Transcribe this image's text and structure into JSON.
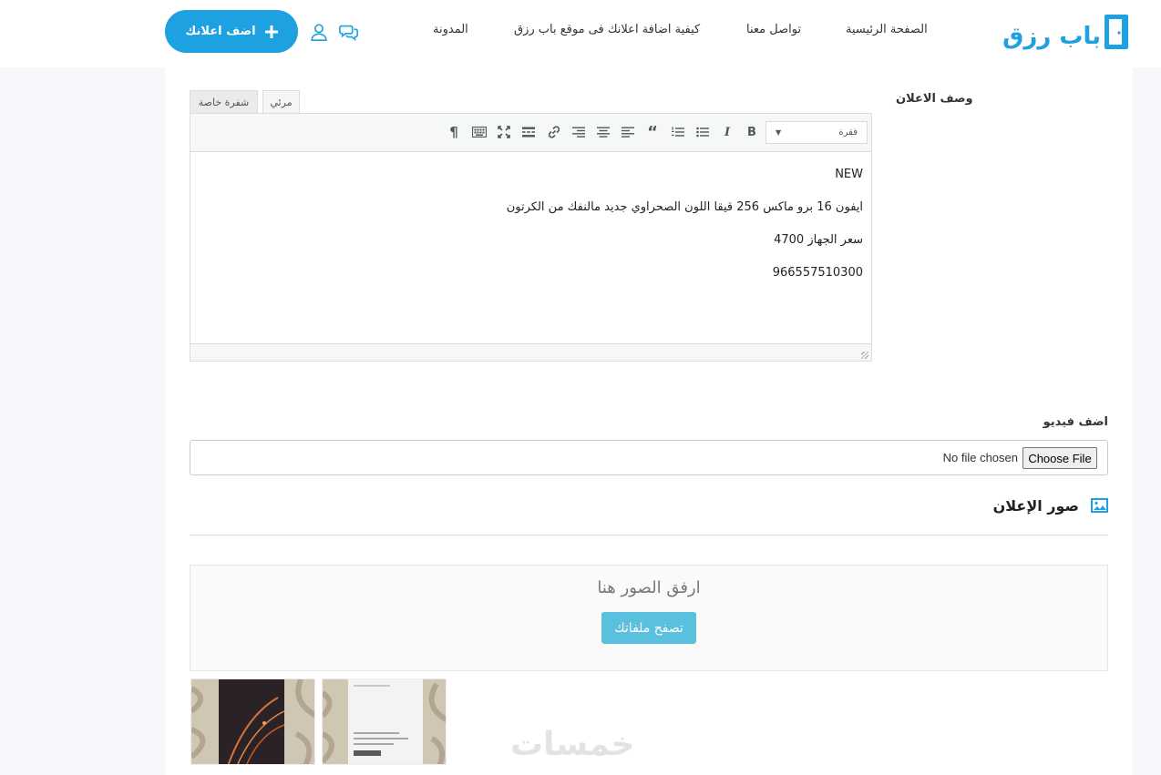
{
  "header": {
    "logo_text": "باب رزق",
    "nav": {
      "home": "الصفحة الرئيسية",
      "contact": "تواصل معنا",
      "how_to": "كيفية اضافة اعلانك فى موقع باب رزق",
      "blog": "المدونة"
    },
    "add_ad_label": "اضف اعلانك",
    "accent_color": "#1da1e0"
  },
  "description": {
    "label": "وصف الاعلان",
    "tabs": {
      "visual": "مرئي",
      "code": "شفرة خاصة"
    },
    "format_select": "فقرة",
    "lines": [
      "NEW",
      "ايفون 16 برو ماكس 256 قيقا اللون الصحراوي جديد مالنفك من الكرتون",
      "سعر الجهاز 4700",
      "966557510300"
    ]
  },
  "video": {
    "label": "اضف فيديو",
    "choose_button": "Choose File",
    "status": "No file chosen"
  },
  "images": {
    "section_title": "صور الإعلان",
    "dropzone_text": "ارفق الصور هنا",
    "browse_button": "تصفح ملفاتك"
  },
  "watermark": "خمسات"
}
